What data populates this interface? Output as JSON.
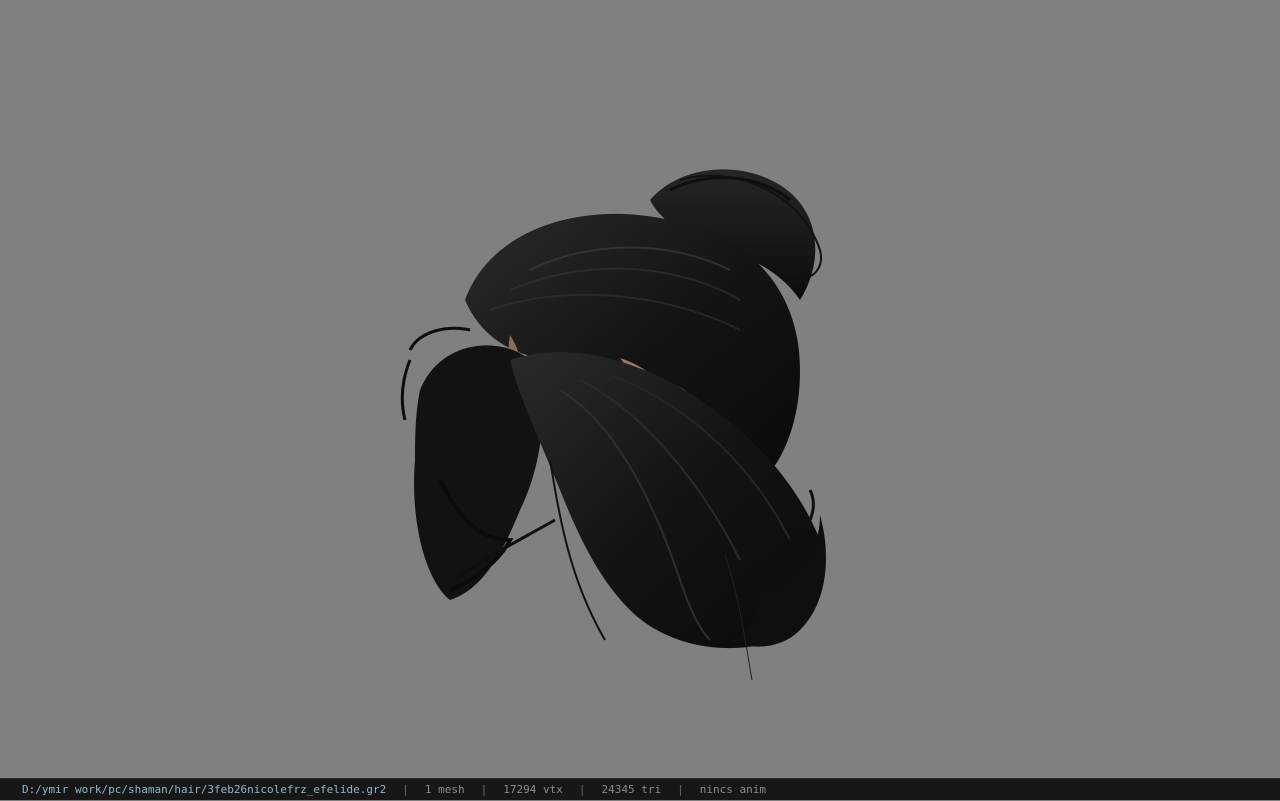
{
  "status_bar": {
    "file_path": "D:/ymir work/pc/shaman/hair/3feb26nicolefrz_efelide.gr2",
    "separator": "|",
    "mesh_count": "1 mesh",
    "vertex_count": "17294 vtx",
    "triangle_count": "24345 tri",
    "animation": "nincs anim"
  },
  "viewport": {
    "background_color": "#808080",
    "model": "hair-model"
  }
}
